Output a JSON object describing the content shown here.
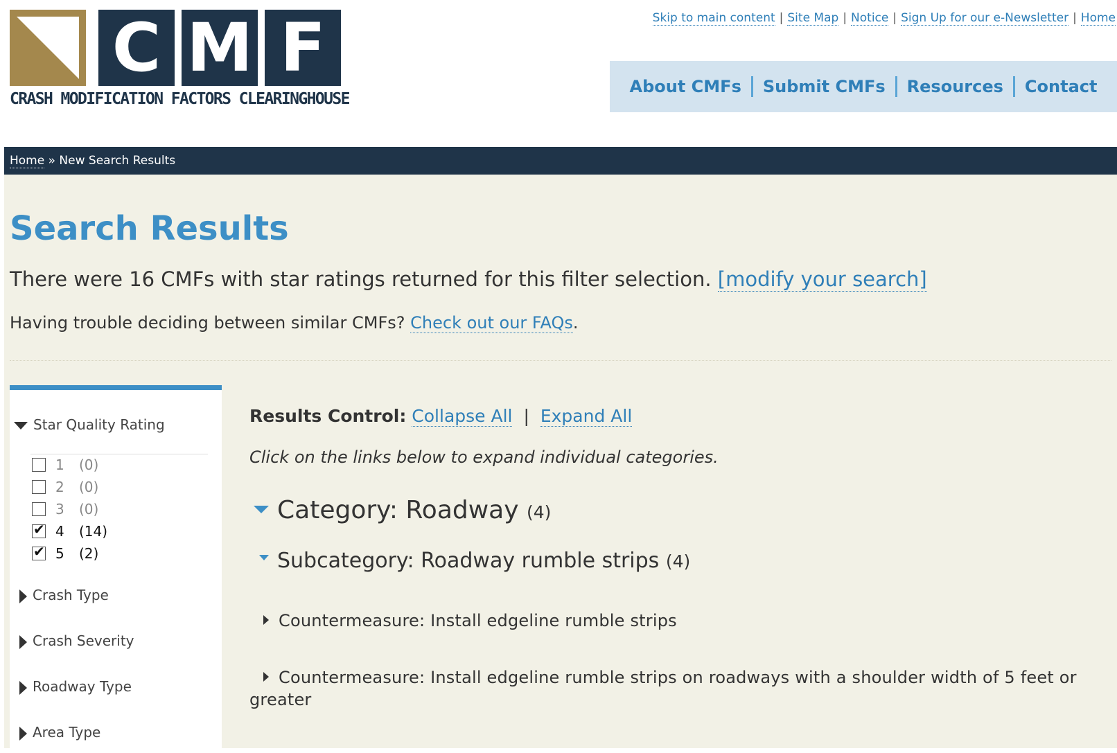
{
  "logo": {
    "letters": [
      "C",
      "M",
      "F"
    ],
    "tagline": "CRASH MODIFICATION FACTORS CLEARINGHOUSE",
    "colors": {
      "gold": "#a4884d",
      "navy": "#1f3449"
    }
  },
  "util_links": [
    "Skip to main content",
    "Site Map",
    "Notice",
    "Sign Up for our e-Newsletter",
    "Home"
  ],
  "util_separator": "|",
  "main_nav": [
    "About CMFs",
    "Submit CMFs",
    "Resources",
    "Contact"
  ],
  "breadcrumb": {
    "home": "Home",
    "separator": "»",
    "current": "New Search Results"
  },
  "page": {
    "title": "Search Results",
    "summary_text": "There were 16 CMFs with star ratings returned for this filter selection.",
    "modify_link": "[modify your search]",
    "help_text": "Having trouble deciding between similar CMFs?",
    "faq_link": "Check out our FAQs",
    "help_end": "."
  },
  "sidebar": {
    "star_heading": "Star Quality Rating",
    "ratings": [
      {
        "label": "1",
        "count": "(0)",
        "checked": false
      },
      {
        "label": "2",
        "count": "(0)",
        "checked": false
      },
      {
        "label": "3",
        "count": "(0)",
        "checked": false
      },
      {
        "label": "4",
        "count": "(14)",
        "checked": true
      },
      {
        "label": "5",
        "count": "(2)",
        "checked": true
      }
    ],
    "facets": [
      "Crash Type",
      "Crash Severity",
      "Roadway Type",
      "Area Type"
    ]
  },
  "results": {
    "control_label": "Results Control:",
    "collapse_all": "Collapse All",
    "pipe": "|",
    "expand_all": "Expand All",
    "hint": "Click on the links below to expand individual categories.",
    "category": {
      "label": "Category: Roadway",
      "count": "(4)"
    },
    "subcategory": {
      "label": "Subcategory: Roadway rumble strips",
      "count": "(4)"
    },
    "countermeasures": [
      "Countermeasure: Install edgeline rumble strips",
      "Countermeasure: Install edgeline rumble strips on roadways with a shoulder width of 5 feet or greater"
    ]
  },
  "colors": {
    "accent": "#3d8fc6",
    "link": "#2f7fb8",
    "navy": "#1f3449",
    "nav_bg": "#d3e3ef",
    "content_bg": "#f2f1e6"
  }
}
